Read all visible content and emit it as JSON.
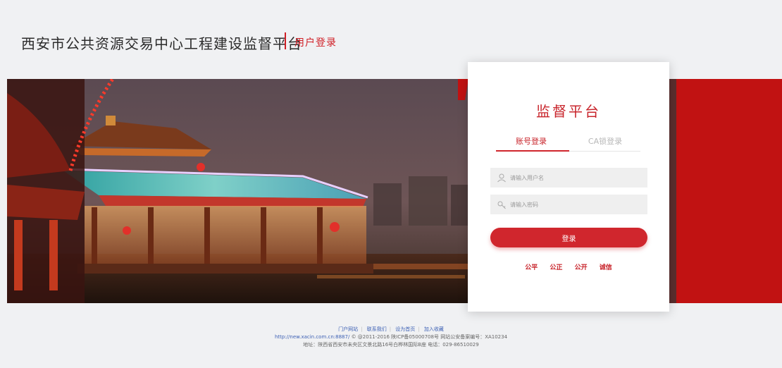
{
  "header": {
    "site_title": "西安市公共资源交易中心工程建设监督平台",
    "sub_title": "用户登录"
  },
  "login": {
    "title": "监督平台",
    "tabs": [
      "账号登录",
      "CA锁登录"
    ],
    "username_placeholder": "请输入用户名",
    "password_placeholder": "请输入密码",
    "login_button": "登录",
    "slogans": [
      "公平",
      "公正",
      "公开",
      "诚信"
    ]
  },
  "footer": {
    "links": [
      "门户网站",
      "联系我们",
      "设为首页",
      "加入收藏"
    ],
    "url": "http://new.xacin.com.cn:8887/",
    "copyright": "© @2011-2016 陕ICP备05000708号 网站公安备案编号：XA10234",
    "address": "地址：陕西省西安市未央区文景北路16号白桦林国际B座 电话：029-86510029"
  },
  "colors": {
    "brand_red": "#d0262d",
    "background": "#f0f1f3"
  },
  "icons": {
    "username": "user-icon",
    "password": "key-icon"
  }
}
